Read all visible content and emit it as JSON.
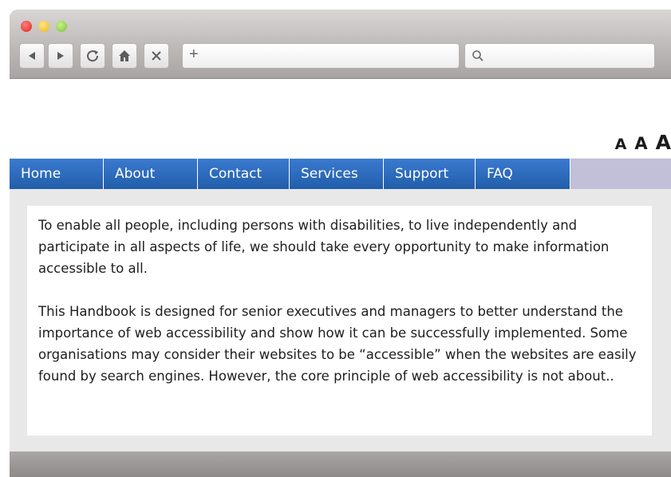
{
  "browser": {
    "window_buttons": [
      "close",
      "minimize",
      "zoom"
    ],
    "toolbar_icons": [
      "back-icon",
      "forward-icon",
      "reload-icon",
      "home-icon",
      "stop-icon"
    ],
    "address_bar": {
      "value": "",
      "new_tab_glyph": "+"
    },
    "search_box": {
      "value": ""
    }
  },
  "header": {
    "text_size_controls": {
      "small": "A",
      "medium": "A",
      "large": "A"
    }
  },
  "nav": {
    "items": [
      {
        "label": "Home"
      },
      {
        "label": "About"
      },
      {
        "label": "Contact"
      },
      {
        "label": "Services"
      },
      {
        "label": "Support"
      },
      {
        "label": "FAQ"
      }
    ]
  },
  "content": {
    "paragraphs": [
      "To enable all people, including persons with disabilities, to live independently and participate in all aspects of life, we should take every opportunity to make information accessible to all.",
      "This Handbook is designed for senior executives and managers to better understand the importance of web accessibility and show how it can be successfully implemented. Some organisations may consider their websites to be “accessible” when the websites are easily found by search engines. However, the core principle of web accessibility is not about.."
    ]
  },
  "colors": {
    "nav_blue": "#2a67bb",
    "nav_strip": "#c2bfd9",
    "chrome_gray": "#b8b4b3"
  }
}
